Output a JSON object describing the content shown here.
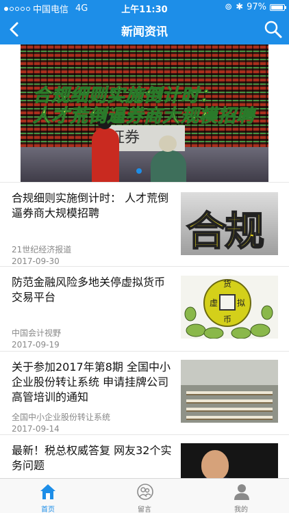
{
  "status_bar": {
    "carrier": "中国电信",
    "network": "4G",
    "time": "上午11:30",
    "battery": "97%",
    "battery_level": 0.97
  },
  "nav": {
    "title": "新闻资讯",
    "back_icon": "chevron-left-icon",
    "search_icon": "search-icon"
  },
  "banner": {
    "caption_line1": "合规细则实施倒计时：",
    "caption_line2": "人才荒倒逼券商大规模招聘",
    "sign_text": "证券"
  },
  "news": [
    {
      "title": "合规细则实施倒计时： 人才荒倒逼券商大规模招聘",
      "source": "21世纪经济报道",
      "date": "2017-09-30",
      "thumb_text": "合规"
    },
    {
      "title": "防范金融风险多地关停虚拟货币交易平台",
      "source": "中国会计视野",
      "date": "2017-09-19",
      "thumb_text": "虚拟货币"
    },
    {
      "title": "关于参加2017年第8期 全国中小企业股份转让系统 申请挂牌公司高管培训的通知",
      "source": "全国中小企业股份转让系统",
      "date": "2017-09-14"
    },
    {
      "title": "最新！税总权威答复 网友32个实务问题"
    }
  ],
  "tabs": [
    {
      "label": "首页",
      "icon": "home-icon"
    },
    {
      "label": "留言",
      "icon": "message-icon"
    },
    {
      "label": "我的",
      "icon": "user-icon"
    }
  ],
  "colors": {
    "primary": "#1d8ee8"
  }
}
